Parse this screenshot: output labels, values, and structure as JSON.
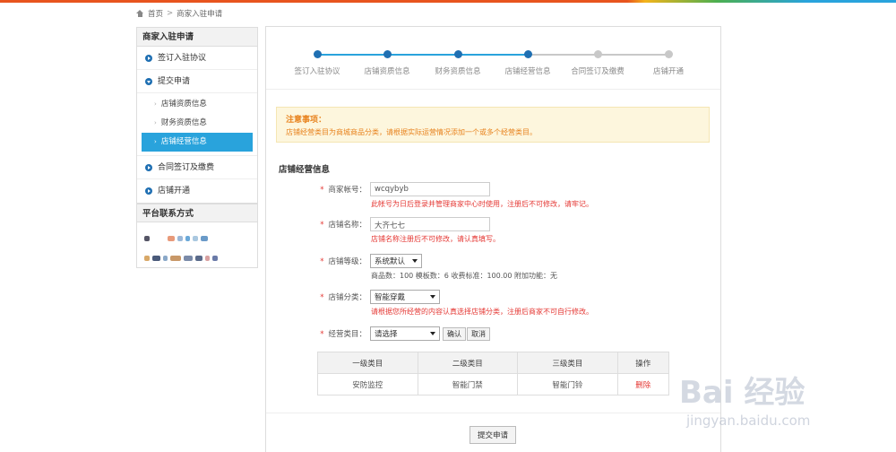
{
  "breadcrumb": {
    "home": "首页",
    "current": "商家入驻申请"
  },
  "sidebar": {
    "title": "商家入驻申请",
    "items": [
      {
        "label": "签订入驻协议"
      },
      {
        "label": "提交申请"
      },
      {
        "label": "合同签订及缴费"
      },
      {
        "label": "店铺开通"
      }
    ],
    "sub_items": [
      {
        "label": "店铺资质信息"
      },
      {
        "label": "财务资质信息"
      },
      {
        "label": "店铺经营信息"
      }
    ],
    "contact_title": "平台联系方式"
  },
  "steps": [
    {
      "label": "签订入驻协议"
    },
    {
      "label": "店铺资质信息"
    },
    {
      "label": "财务资质信息"
    },
    {
      "label": "店铺经营信息"
    },
    {
      "label": "合同签订及缴费"
    },
    {
      "label": "店铺开通"
    }
  ],
  "colors": {
    "active": "#29a3dc",
    "active_dot": "#1f6fb2",
    "inactive": "#c8c8c8",
    "danger": "#e53935",
    "notice": "#e8831e"
  },
  "notice": {
    "title": "注意事项：",
    "text": "店铺经营类目为商城商品分类，请根据实际运营情况添加一个或多个经营类目。"
  },
  "section_title": "店铺经营信息",
  "form": {
    "account_label": "商家帐号：",
    "account_value": "wcqybyb",
    "account_hint": "此帐号为日后登录并管理商家中心时使用，注册后不可修改，请牢记。",
    "shop_name_label": "店铺名称：",
    "shop_name_value": "大齐七七",
    "shop_name_hint": "店铺名称注册后不可修改，请认真填写。",
    "level_label": "店铺等级：",
    "level_value": "系统默认",
    "level_info": "商品数：100 模板数：6 收费标准：100.00 附加功能：无",
    "category_label": "店铺分类：",
    "category_value": "智能穿戴",
    "category_hint": "请根据您所经营的内容认真选择店铺分类，注册后商家不可自行修改。",
    "biz_label": "经营类目：",
    "biz_value": "请选择",
    "confirm": "确认",
    "cancel": "取消"
  },
  "table": {
    "headers": [
      "一级类目",
      "二级类目",
      "三级类目",
      "操作"
    ],
    "rows": [
      [
        "安防监控",
        "智能门禁",
        "智能门铃",
        "删除"
      ]
    ]
  },
  "submit": "提交申请",
  "watermark": {
    "logo": "Bai 经验",
    "url": "jingyan.baidu.com"
  }
}
